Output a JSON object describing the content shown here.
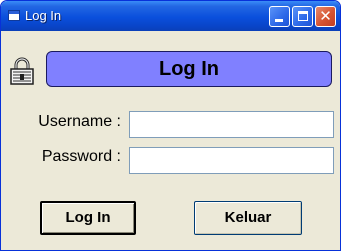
{
  "window": {
    "title": "Log In",
    "app_icon": "window-app-icon",
    "controls": {
      "minimize": "minimize-icon",
      "maximize": "maximize-icon",
      "close": "close-icon",
      "close_glyph": "✕"
    }
  },
  "header": {
    "icon": "padlock-icon",
    "title": "Log In",
    "banner_color": "#8080ff"
  },
  "form": {
    "username_label": "Username :",
    "password_label": "Password :",
    "username_value": "",
    "password_value": ""
  },
  "buttons": {
    "login_label": "Log In",
    "exit_label": "Keluar"
  },
  "colors": {
    "titlebar": "#0a4fdc",
    "window_bg": "#ece9d8",
    "close_button": "#d65432"
  }
}
